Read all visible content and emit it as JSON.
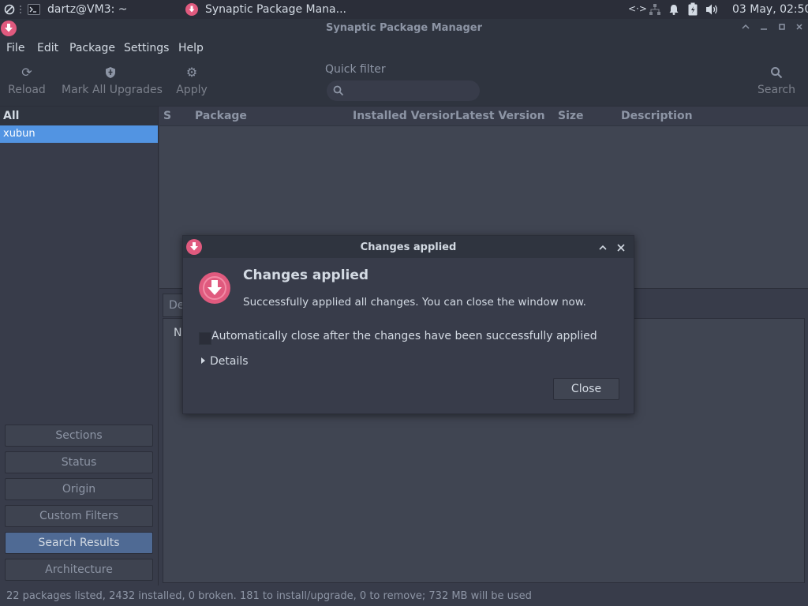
{
  "panel": {
    "terminal_title": "dartz@VM3: ~",
    "app_title": "Synaptic Package Mana...",
    "clock": "03 May, 02:50"
  },
  "window": {
    "title": "Synaptic Package Manager"
  },
  "menu": {
    "file": "File",
    "edit": "Edit",
    "package": "Package",
    "settings": "Settings",
    "help": "Help"
  },
  "toolbar": {
    "reload": "Reload",
    "mark_all_upgrades": "Mark All Upgrades",
    "apply": "Apply",
    "quick_filter_label": "Quick filter",
    "quick_filter_value": "",
    "search": "Search"
  },
  "left_pane": {
    "header": "All",
    "selected_item": "xubun",
    "filters": {
      "sections": "Sections",
      "status": "Status",
      "origin": "Origin",
      "custom_filters": "Custom Filters",
      "search_results": "Search Results",
      "architecture": "Architecture"
    },
    "active_filter": "Search Results"
  },
  "package_list": {
    "columns": {
      "s": "S",
      "package": "Package",
      "installed_version": "Installed Versior",
      "latest_version": "Latest Version",
      "size": "Size",
      "description": "Description"
    }
  },
  "details": {
    "tab_label": "De",
    "body_text": "N"
  },
  "statusbar": {
    "text": "22 packages listed, 2432 installed, 0 broken. 181 to install/upgrade, 0 to remove; 732 MB will be used"
  },
  "dialog": {
    "title": "Changes applied",
    "heading": "Changes applied",
    "message": "Successfully applied all changes. You can close the window now.",
    "auto_close_label": "Automatically close after the changes have been successfully applied",
    "auto_close_checked": false,
    "details_label": "Details",
    "close_label": "Close"
  },
  "colors": {
    "accent": "#5294e2",
    "brand_pink": "#e05a7e",
    "background": "#383c4a"
  }
}
